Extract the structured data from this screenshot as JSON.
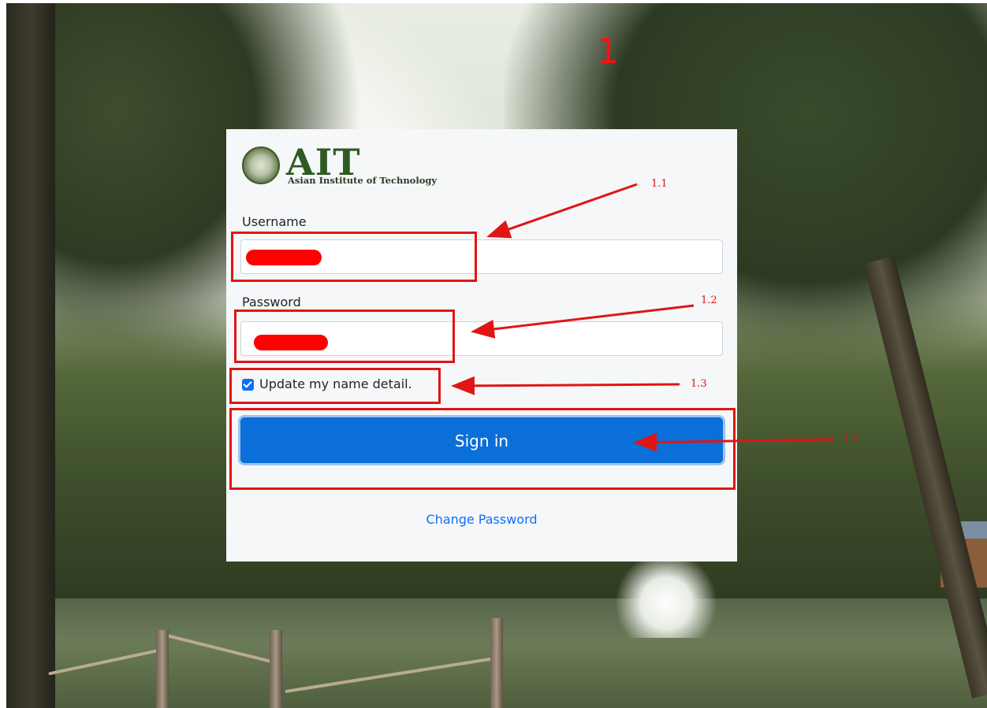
{
  "logo": {
    "name": "AIT",
    "subtitle": "Asian Institute of Technology"
  },
  "form": {
    "username_label": "Username",
    "password_label": "Password",
    "checkbox_label": "Update my name detail.",
    "checkbox_checked": true,
    "signin_label": "Sign in",
    "change_password_label": "Change Password"
  },
  "annotations": {
    "step": "1",
    "a1": "1.1",
    "a2": "1.2",
    "a3": "1.3",
    "a4": "1.4"
  },
  "colors": {
    "primary": "#0a6fd9",
    "annotation": "#e01515",
    "redaction": "#ff0000"
  }
}
